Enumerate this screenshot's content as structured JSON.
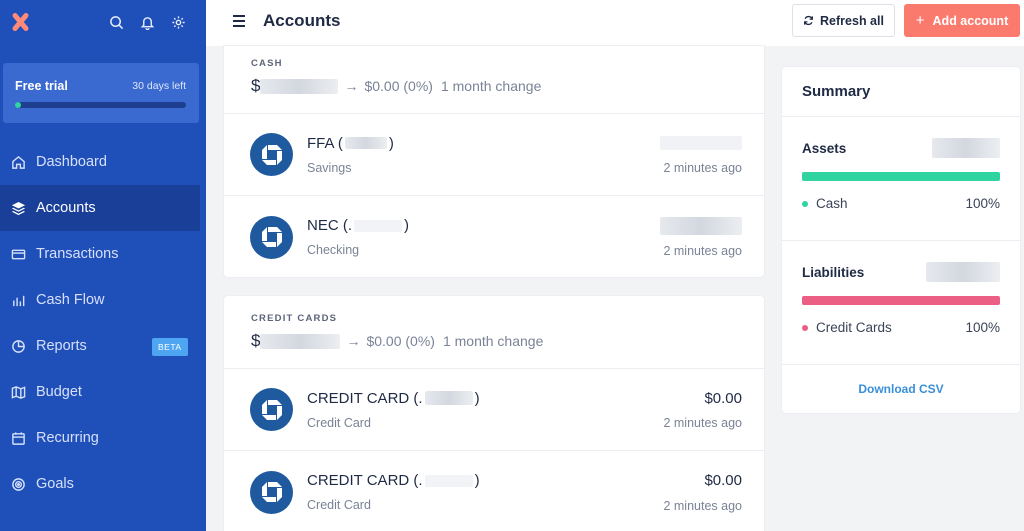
{
  "sidebar": {
    "trial": {
      "title": "Free trial",
      "days_left": "30 days left",
      "progress": 0.03
    },
    "nav": [
      {
        "label": "Dashboard",
        "icon": "home-icon"
      },
      {
        "label": "Accounts",
        "icon": "layers-icon",
        "active": true
      },
      {
        "label": "Transactions",
        "icon": "card-icon"
      },
      {
        "label": "Cash Flow",
        "icon": "bar-chart-icon"
      },
      {
        "label": "Reports",
        "icon": "pie-chart-icon",
        "badge": "BETA"
      },
      {
        "label": "Budget",
        "icon": "map-icon"
      },
      {
        "label": "Recurring",
        "icon": "calendar-icon"
      },
      {
        "label": "Goals",
        "icon": "target-icon"
      }
    ]
  },
  "header": {
    "title": "Accounts",
    "refresh_label": "Refresh all",
    "add_label": "Add account",
    "add_icon": "+"
  },
  "cash": {
    "label": "CASH",
    "currency": "$",
    "change_arrow": "→",
    "change": "$0.00 (0%)",
    "period": "1 month change",
    "accounts": [
      {
        "name": "FFA (",
        "name_close": ")",
        "type": "Savings",
        "balance": "",
        "updated": "2 minutes ago"
      },
      {
        "name": "NEC (.",
        "name_close": ")",
        "type": "Checking",
        "balance": "",
        "updated": "2 minutes ago"
      }
    ]
  },
  "credit": {
    "label": "CREDIT CARDS",
    "currency": "$",
    "change_arrow": "→",
    "change": "$0.00 (0%)",
    "period": "1 month change",
    "accounts": [
      {
        "name": "CREDIT CARD (.",
        "name_close": ")",
        "type": "Credit Card",
        "balance": "$0.00",
        "updated": "2 minutes ago"
      },
      {
        "name": "CREDIT CARD (.",
        "name_close": ")",
        "type": "Credit Card",
        "balance": "$0.00",
        "updated": "2 minutes ago"
      }
    ]
  },
  "summary": {
    "title": "Summary",
    "assets": {
      "label": "Assets",
      "item": "Cash",
      "pct": "100%",
      "color": "#2fd4a0"
    },
    "liabilities": {
      "label": "Liabilities",
      "item": "Credit Cards",
      "pct": "100%",
      "color": "#eb5f84"
    },
    "download_label": "Download CSV"
  }
}
